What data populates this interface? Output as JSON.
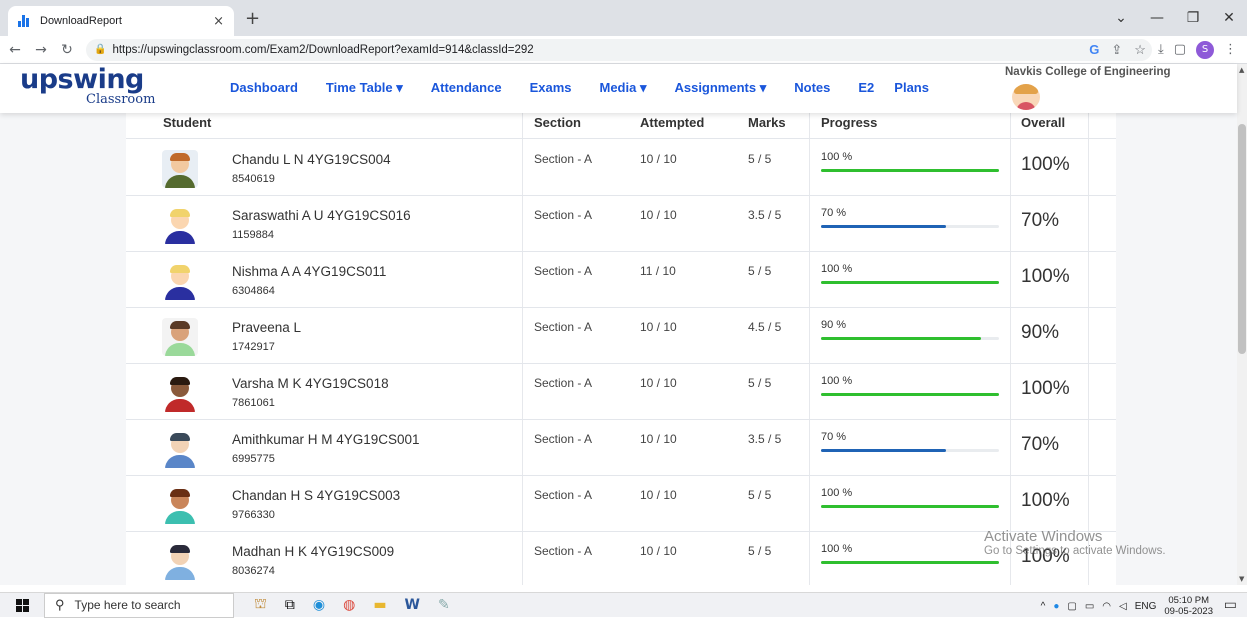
{
  "browser": {
    "tab_title": "DownloadReport",
    "tab_close": "×",
    "new_tab": "+",
    "url": "https://upswingclassroom.com/Exam2/DownloadReport?examId=914&classId=292",
    "profile_initial": "S",
    "window_controls": [
      "⌄",
      "—",
      "❐",
      "✕"
    ]
  },
  "app": {
    "logo_top": "upswing",
    "logo_bottom": "Classroom",
    "menu": [
      "Dashboard",
      "Time Table ▾",
      "Attendance",
      "Exams",
      "Media ▾",
      "Assignments ▾",
      "Notes",
      "E2",
      "Plans"
    ],
    "college": "Navkis College of Engineering"
  },
  "table": {
    "headers": {
      "student": "Student",
      "section": "Section",
      "attempted": "Attempted",
      "marks": "Marks",
      "progress": "Progress",
      "overall": "Overall"
    },
    "rows": [
      {
        "name": "Chandu L N 4YG19CS004",
        "id": "8540619",
        "section": "Section - A",
        "attempted": "10 / 10",
        "marks": "5 / 5",
        "progress_label": "100 %",
        "progress": 100,
        "overall": "100%",
        "bar_color": "#2fbf2f",
        "avatar": {
          "bg": "#e8eef4",
          "skin": "#f2c9a0",
          "hair": "#c06a2b",
          "body": "#556b2f"
        }
      },
      {
        "name": "Saraswathi A U 4YG19CS016",
        "id": "1159884",
        "section": "Section - A",
        "attempted": "10 / 10",
        "marks": "3.5 / 5",
        "progress_label": "70 %",
        "progress": 70,
        "overall": "70%",
        "bar_color": "#1f63b5",
        "avatar": {
          "bg": "#ffffff",
          "skin": "#fbd6b0",
          "hair": "#f1d36c",
          "body": "#2a2fa0"
        }
      },
      {
        "name": "Nishma A A 4YG19CS011",
        "id": "6304864",
        "section": "Section - A",
        "attempted": "11 / 10",
        "marks": "5 / 5",
        "progress_label": "100 %",
        "progress": 100,
        "overall": "100%",
        "bar_color": "#2fbf2f",
        "avatar": {
          "bg": "#ffffff",
          "skin": "#fbd6b0",
          "hair": "#f1d36c",
          "body": "#2a2fa0"
        }
      },
      {
        "name": "Praveena L",
        "id": "1742917",
        "section": "Section - A",
        "attempted": "10 / 10",
        "marks": "4.5 / 5",
        "progress_label": "90 %",
        "progress": 90,
        "overall": "90%",
        "bar_color": "#2fbf2f",
        "avatar": {
          "bg": "#f3f3f3",
          "skin": "#d9a27a",
          "hair": "#5a3a26",
          "body": "#9ad99a"
        }
      },
      {
        "name": "Varsha M K 4YG19CS018",
        "id": "7861061",
        "section": "Section - A",
        "attempted": "10 / 10",
        "marks": "5 / 5",
        "progress_label": "100 %",
        "progress": 100,
        "overall": "100%",
        "bar_color": "#2fbf2f",
        "avatar": {
          "bg": "#ffffff",
          "skin": "#8a5a3b",
          "hair": "#2a1a10",
          "body": "#c02a2a"
        }
      },
      {
        "name": "Amithkumar H M 4YG19CS001",
        "id": "6995775",
        "section": "Section - A",
        "attempted": "10 / 10",
        "marks": "3.5 / 5",
        "progress_label": "70 %",
        "progress": 70,
        "overall": "70%",
        "bar_color": "#1f63b5",
        "avatar": {
          "bg": "#ffffff",
          "skin": "#f2d3b6",
          "hair": "#3a4a5a",
          "body": "#5a86c8"
        }
      },
      {
        "name": "Chandan H S 4YG19CS003",
        "id": "9766330",
        "section": "Section - A",
        "attempted": "10 / 10",
        "marks": "5 / 5",
        "progress_label": "100 %",
        "progress": 100,
        "overall": "100%",
        "bar_color": "#2fbf2f",
        "avatar": {
          "bg": "#ffffff",
          "skin": "#c9855a",
          "hair": "#6a2f14",
          "body": "#3cbfb0"
        }
      },
      {
        "name": "Madhan H K 4YG19CS009",
        "id": "8036274",
        "section": "Section - A",
        "attempted": "10 / 10",
        "marks": "5 / 5",
        "progress_label": "100 %",
        "progress": 100,
        "overall": "100%",
        "bar_color": "#2fbf2f",
        "avatar": {
          "bg": "#ffffff",
          "skin": "#f2d3b6",
          "hair": "#2a2a3a",
          "body": "#7fb0e0"
        }
      }
    ]
  },
  "watermark": {
    "line1": "Activate Windows",
    "line2": "Go to Settings to activate Windows."
  },
  "taskbar": {
    "search_placeholder": "Type here to search",
    "tray_lang": "ENG",
    "time": "05:10 PM",
    "date": "09-05-2023"
  }
}
